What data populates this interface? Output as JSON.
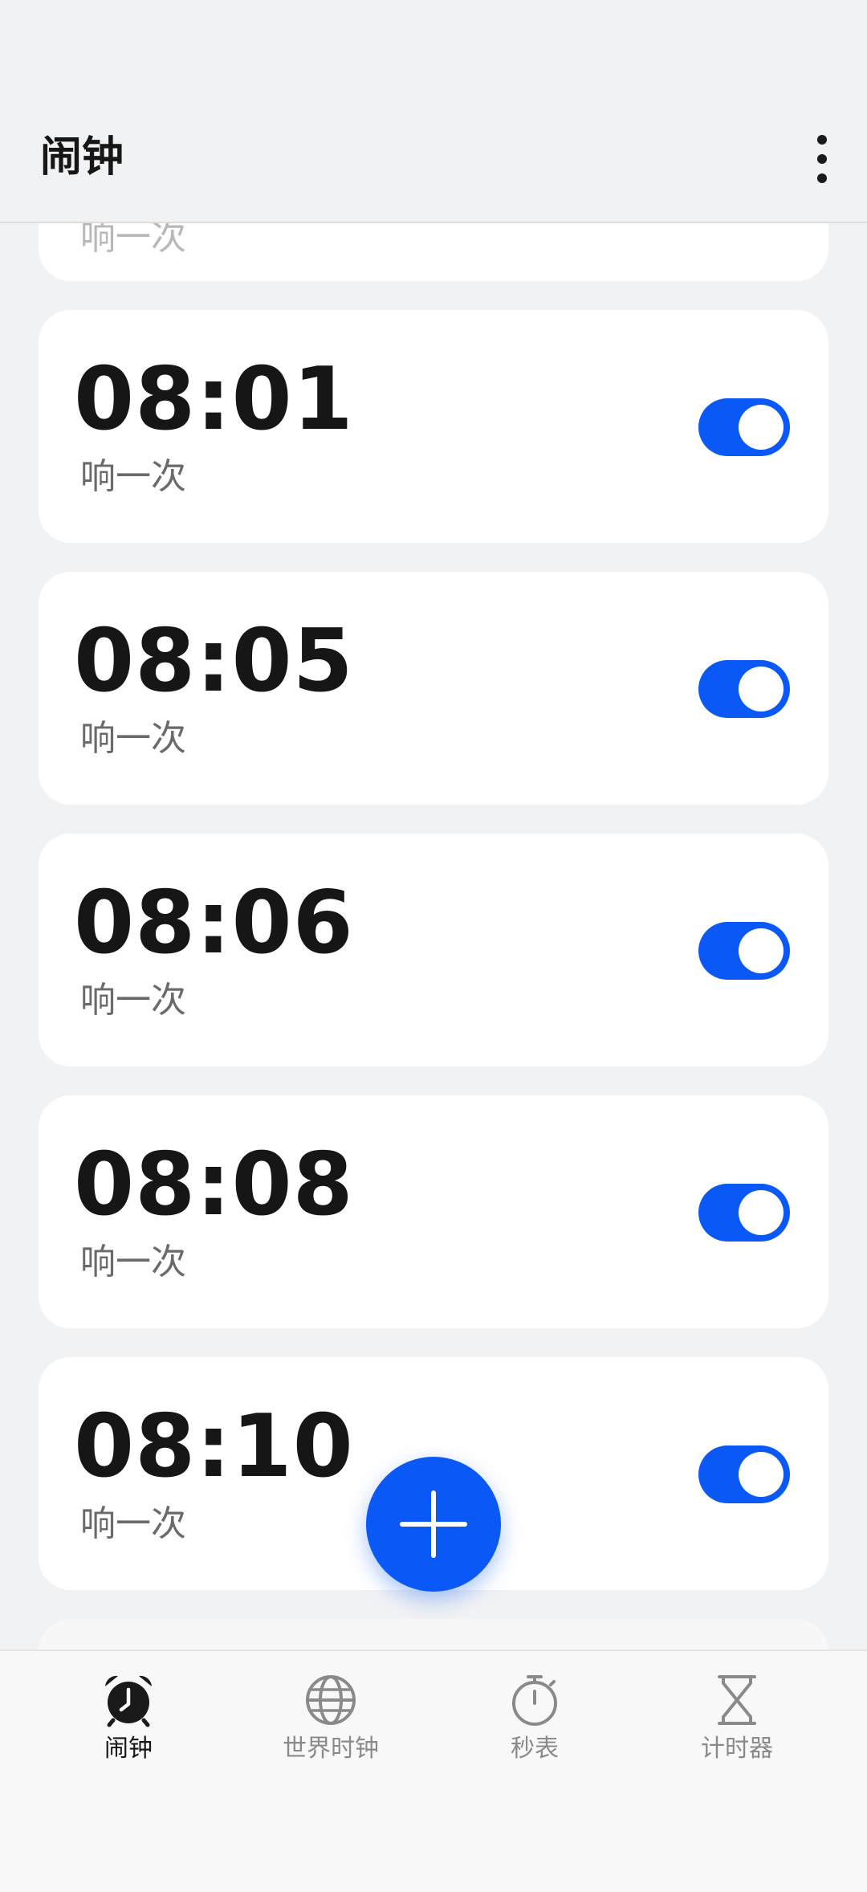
{
  "appbar": {
    "title": "闹钟",
    "more_icon": "more-vertical-icon"
  },
  "alarms": {
    "partial_top": {
      "repeat": "响一次"
    },
    "items": [
      {
        "time": "08:01",
        "repeat": "响一次",
        "enabled": true
      },
      {
        "time": "08:05",
        "repeat": "响一次",
        "enabled": true
      },
      {
        "time": "08:06",
        "repeat": "响一次",
        "enabled": true
      },
      {
        "time": "08:08",
        "repeat": "响一次",
        "enabled": true
      },
      {
        "time": "08:10",
        "repeat": "响一次",
        "enabled": true
      }
    ]
  },
  "fab": {
    "icon": "plus-icon"
  },
  "tabs": [
    {
      "label": "闹钟",
      "icon": "alarm-clock-icon",
      "active": true
    },
    {
      "label": "世界时钟",
      "icon": "globe-icon",
      "active": false
    },
    {
      "label": "秒表",
      "icon": "stopwatch-icon",
      "active": false
    },
    {
      "label": "计时器",
      "icon": "hourglass-icon",
      "active": false
    }
  ],
  "colors": {
    "accent": "#0a59f7",
    "background": "#f1f2f4",
    "card": "#ffffff",
    "text_primary": "#161616",
    "text_secondary": "#6a6a6a"
  }
}
